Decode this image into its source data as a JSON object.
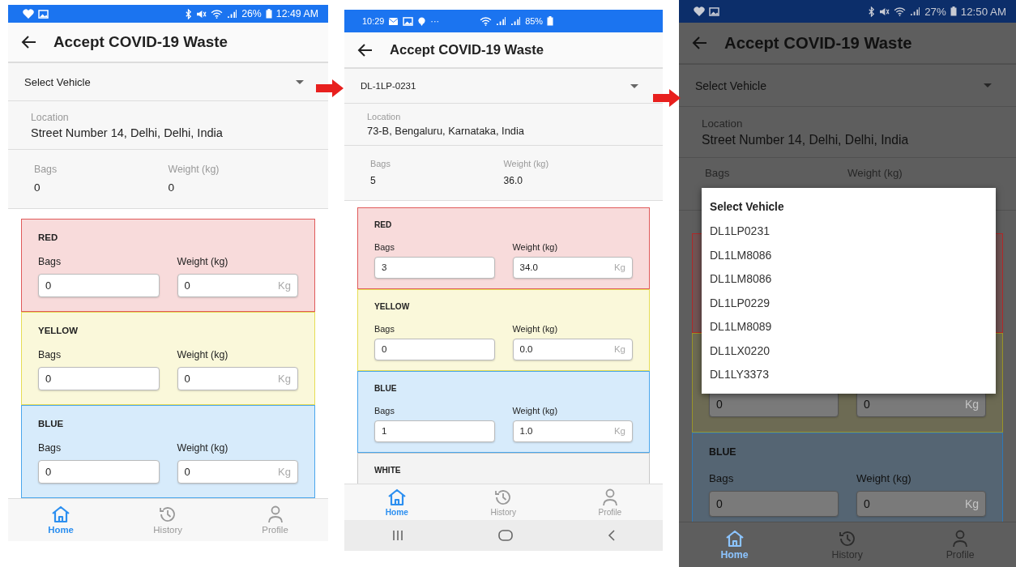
{
  "screens": [
    {
      "status_bar": {
        "battery": "26%",
        "time": "12:49 AM"
      },
      "title": "Accept COVID-19 Waste",
      "vehicle_select": {
        "value": "Select Vehicle"
      },
      "location": {
        "label": "Location",
        "value": "Street Number 14, Delhi, Delhi, India"
      },
      "summary": {
        "bags_label": "Bags",
        "bags": "0",
        "weight_label": "Weight (kg)",
        "weight": "0"
      },
      "sections": [
        {
          "name": "RED",
          "color": "#e05a5a",
          "bags_label": "Bags",
          "bags": "0",
          "weight_label": "Weight (kg)",
          "weight": "0",
          "unit": "Kg"
        },
        {
          "name": "YELLOW",
          "color": "#e6dd55",
          "bags_label": "Bags",
          "bags": "0",
          "weight_label": "Weight (kg)",
          "weight": "0",
          "unit": "Kg"
        },
        {
          "name": "BLUE",
          "color": "#4aa6ec",
          "bags_label": "Bags",
          "bags": "0",
          "weight_label": "Weight (kg)",
          "weight": "0",
          "unit": "Kg"
        }
      ],
      "nav": [
        {
          "label": "Home",
          "selected": true
        },
        {
          "label": "History",
          "selected": false
        },
        {
          "label": "Profile",
          "selected": false
        }
      ],
      "system_nav_bar": false,
      "dimmed": false
    },
    {
      "status_bar": {
        "time": "10:29",
        "overflow": "···",
        "battery": "85%"
      },
      "title": "Accept COVID-19 Waste",
      "vehicle_select": {
        "value": "DL-1LP-0231"
      },
      "location": {
        "label": "Location",
        "value": "73-B, Bengaluru, Karnataka, India"
      },
      "summary": {
        "bags_label": "Bags",
        "bags": "5",
        "weight_label": "Weight (kg)",
        "weight": "36.0"
      },
      "sections": [
        {
          "name": "RED",
          "color": "#e05a5a",
          "bags_label": "Bags",
          "bags": "3",
          "weight_label": "Weight (kg)",
          "weight": "34.0",
          "unit": "Kg"
        },
        {
          "name": "YELLOW",
          "color": "#e6dd55",
          "bags_label": "Bags",
          "bags": "0",
          "weight_label": "Weight (kg)",
          "weight": "0.0",
          "unit": "Kg"
        },
        {
          "name": "BLUE",
          "color": "#4aa6ec",
          "bags_label": "Bags",
          "bags": "1",
          "weight_label": "Weight (kg)",
          "weight": "1.0",
          "unit": "Kg"
        },
        {
          "name": "WHITE",
          "color": "#c8c8c8"
        }
      ],
      "nav": [
        {
          "label": "Home",
          "selected": true
        },
        {
          "label": "History",
          "selected": false
        },
        {
          "label": "Profile",
          "selected": false
        }
      ],
      "system_nav_bar": true,
      "dimmed": false
    },
    {
      "status_bar": {
        "battery": "27%",
        "time": "12:50 AM"
      },
      "title": "Accept COVID-19 Waste",
      "vehicle_select": {
        "value": "Select Vehicle"
      },
      "location": {
        "label": "Location",
        "value": "Street Number 14, Delhi, Delhi, India"
      },
      "summary": {
        "bags_label": "Bags",
        "weight_label": "Weight (kg)"
      },
      "sections": [
        {
          "color": "#b02a2a"
        },
        {
          "color": "#9a9428",
          "bags": "0",
          "weight": "0",
          "unit": "Kg"
        },
        {
          "name": "BLUE",
          "color": "#2f78b8",
          "bags_label": "Bags",
          "bags": "0",
          "weight_label": "Weight (kg)",
          "weight": "0",
          "unit": "Kg"
        }
      ],
      "nav": [
        {
          "label": "Home",
          "selected": true
        },
        {
          "label": "History",
          "selected": false
        },
        {
          "label": "Profile",
          "selected": false
        }
      ],
      "system_nav_bar": false,
      "dimmed": true,
      "dialog": {
        "title": "Select Vehicle",
        "options": [
          "DL1LP0231",
          "DL1LM8086",
          "DL1LM8086",
          "DL1LP0229",
          "DL1LM8089",
          "DL1LX0220",
          "DL1LY3373"
        ]
      }
    }
  ]
}
